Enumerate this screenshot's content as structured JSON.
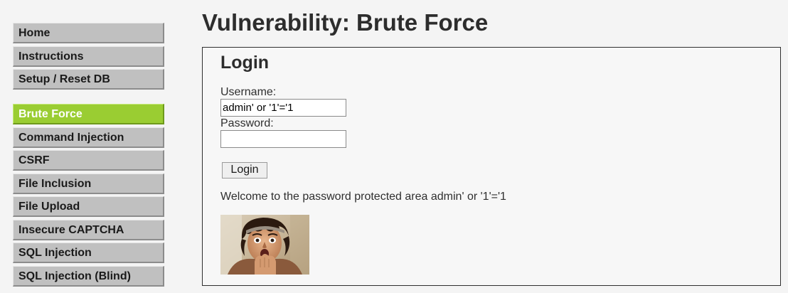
{
  "menu": {
    "group1": [
      {
        "label": "Home"
      },
      {
        "label": "Instructions"
      },
      {
        "label": "Setup / Reset DB"
      }
    ],
    "group2": [
      {
        "label": "Brute Force",
        "selected": true
      },
      {
        "label": "Command Injection"
      },
      {
        "label": "CSRF"
      },
      {
        "label": "File Inclusion"
      },
      {
        "label": "File Upload"
      },
      {
        "label": "Insecure CAPTCHA"
      },
      {
        "label": "SQL Injection"
      },
      {
        "label": "SQL Injection (Blind)"
      }
    ]
  },
  "page": {
    "title": "Vulnerability: Brute Force"
  },
  "login": {
    "heading": "Login",
    "username_label": "Username:",
    "username_value": "admin' or '1'='1",
    "password_label": "Password:",
    "password_value": "",
    "button_label": "Login",
    "welcome_message": "Welcome to the password protected area admin' or '1'='1"
  },
  "colors": {
    "menu_selected": "#9acd32",
    "menu_default": "#c0c0c0",
    "background": "#f4f4f4"
  }
}
